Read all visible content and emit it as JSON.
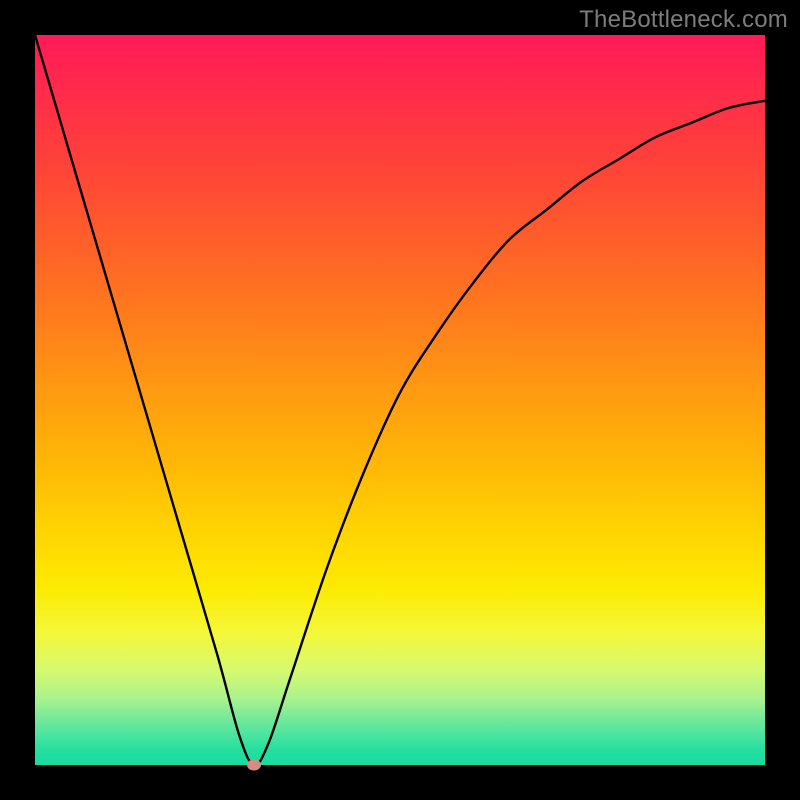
{
  "watermark": "TheBottleneck.com",
  "chart_data": {
    "type": "line",
    "title": "",
    "xlabel": "",
    "ylabel": "",
    "xlim": [
      0,
      100
    ],
    "ylim": [
      0,
      100
    ],
    "grid": false,
    "legend": false,
    "series": [
      {
        "name": "curve",
        "x": [
          0,
          5,
          10,
          15,
          20,
          25,
          28,
          30,
          32,
          35,
          40,
          45,
          50,
          55,
          60,
          65,
          70,
          75,
          80,
          85,
          90,
          95,
          100
        ],
        "y": [
          100,
          83,
          66,
          49,
          32,
          15,
          4,
          0,
          3,
          12,
          27,
          40,
          51,
          59,
          66,
          72,
          76,
          80,
          83,
          86,
          88,
          90,
          91
        ]
      }
    ],
    "marker": {
      "x": 30,
      "y": 0,
      "color": "#d98b82"
    },
    "background_gradient": {
      "top": "#ff1a58",
      "mid": "#ffd402",
      "bottom": "#18dca0"
    }
  }
}
